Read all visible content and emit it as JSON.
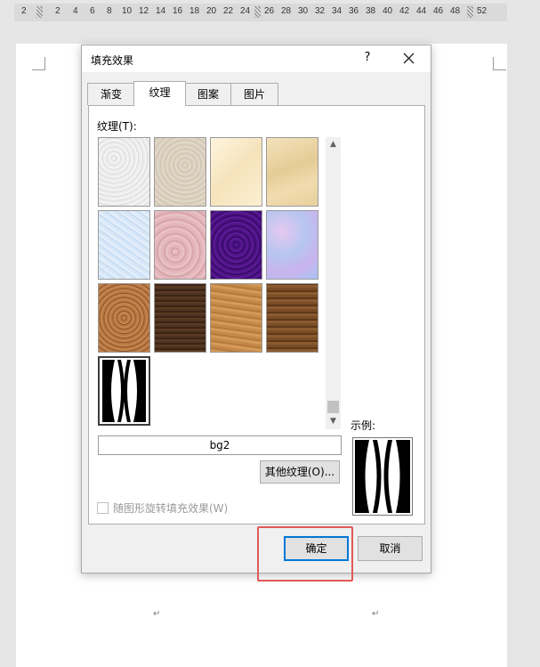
{
  "ruler": {
    "ticks": [
      "2",
      "2",
      "4",
      "6",
      "8",
      "10",
      "12",
      "14",
      "16",
      "18",
      "20",
      "22",
      "24",
      "26",
      "28",
      "30",
      "32",
      "34",
      "36",
      "38",
      "40",
      "42",
      "44",
      "46",
      "48",
      "52"
    ]
  },
  "dialog": {
    "title": "填充效果",
    "help_label": "?",
    "tabs": [
      {
        "label": "渐变"
      },
      {
        "label": "纹理"
      },
      {
        "label": "图案"
      },
      {
        "label": "图片"
      }
    ],
    "texture_label": "纹理(T):",
    "textures": [
      {
        "name": "newsprint",
        "color": "#ececec"
      },
      {
        "name": "recycled-paper",
        "color": "#d9cfbe"
      },
      {
        "name": "parchment",
        "color": "#fbeed0"
      },
      {
        "name": "stationery",
        "color": "#ecd8aa"
      },
      {
        "name": "blue-tissue-paper",
        "color": "#cfe2f6"
      },
      {
        "name": "pink-tissue-paper",
        "color": "#e0b3b8"
      },
      {
        "name": "purple-mesh",
        "color": "#4e1383"
      },
      {
        "name": "bouquet",
        "color": "#b6c6f0"
      },
      {
        "name": "cork",
        "color": "#b5763f"
      },
      {
        "name": "walnut",
        "color": "#4e3320"
      },
      {
        "name": "oak",
        "color": "#c58a4a"
      },
      {
        "name": "medium-wood",
        "color": "#7a4d26"
      },
      {
        "name": "bg2",
        "color": "#ffffff"
      }
    ],
    "selected_texture_name": "bg2",
    "other_texture_label": "其他纹理(O)...",
    "sample_label": "示例:",
    "rotate_label": "随图形旋转填充效果(W)",
    "ok_label": "确定",
    "cancel_label": "取消"
  },
  "document": {
    "paragraph_marks": [
      "↵",
      "↵"
    ]
  },
  "colors": {
    "highlight": "#e05a5a",
    "default_button_border": "#0078d7"
  }
}
